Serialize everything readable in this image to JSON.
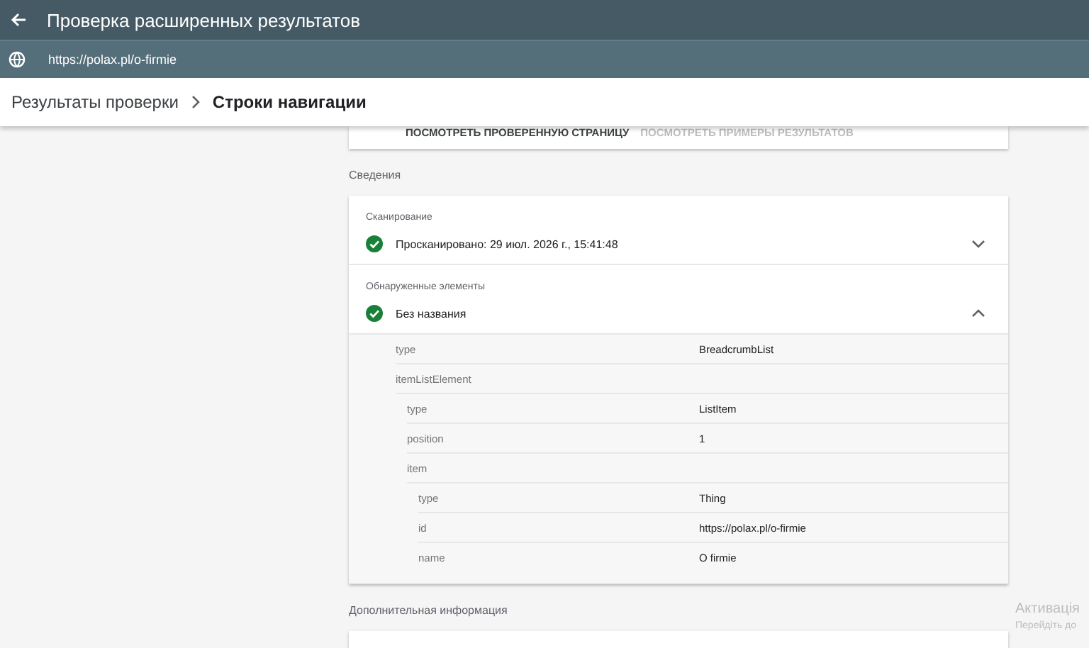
{
  "app_bar": {
    "title": "Проверка расширенных результатов"
  },
  "url_bar": {
    "url": "https://polax.pl/o-firmie"
  },
  "breadcrumb": [
    {
      "label": "Результаты проверки",
      "current": false
    },
    {
      "label": "Строки навигации",
      "current": true
    }
  ],
  "top_card": {
    "buttons": [
      {
        "label": "ПОСМОТРЕТЬ ПРОВЕРЕННУЮ СТРАНИЦУ",
        "disabled": false
      },
      {
        "label": "ПОСМОТРЕТЬ ПРИМЕРЫ РЕЗУЛЬТАТОВ",
        "disabled": true
      }
    ]
  },
  "details": {
    "heading": "Сведения",
    "sections": [
      {
        "label": "Сканирование",
        "passed": true,
        "text": "Просканировано: 29 июл. 2026 г., 15:41:48",
        "expanded": false
      },
      {
        "label": "Обнаруженные элементы",
        "passed": true,
        "text": "Без названия",
        "expanded": true,
        "properties": [
          {
            "key": "type",
            "value": "BreadcrumbList"
          },
          {
            "key": "itemListElement",
            "children": [
              {
                "key": "type",
                "value": "ListItem"
              },
              {
                "key": "position",
                "value": "1"
              },
              {
                "key": "item",
                "children": [
                  {
                    "key": "type",
                    "value": "Thing"
                  },
                  {
                    "key": "id",
                    "value": "https://polax.pl/o-firmie"
                  },
                  {
                    "key": "name",
                    "value": "O firmie"
                  }
                ]
              }
            ]
          }
        ]
      }
    ]
  },
  "more_info": {
    "heading": "Дополнительная информация"
  },
  "activation_notice": {
    "title": "Активація",
    "subtitle": "Перейдіть до"
  }
}
